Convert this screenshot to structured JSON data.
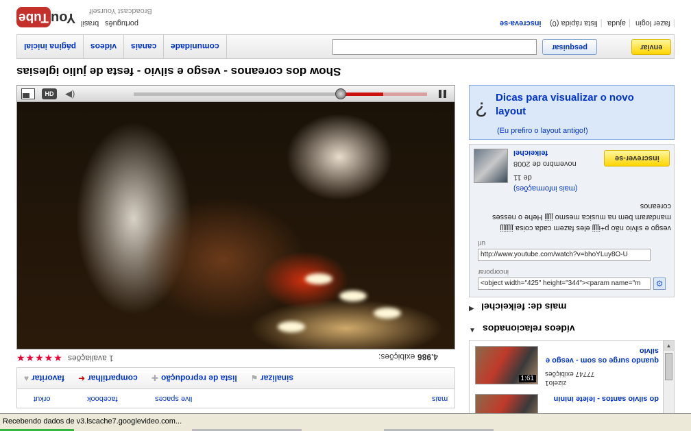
{
  "header": {
    "logo_you": "You",
    "logo_tube": "Tube",
    "tagline": "Broadcast Yourself",
    "languages": [
      "brasil",
      "português"
    ],
    "top_links": [
      "inscreva-se",
      "lista rápida (0)",
      "ajuda",
      "fazer login"
    ]
  },
  "nav": {
    "tabs": [
      "página inicial",
      "vídeos",
      "canais",
      "comunidade"
    ],
    "search_placeholder": "",
    "search_label": "pesquisar",
    "upload_label": "enviar"
  },
  "video": {
    "title": "Show dos coreanos - vesgo e silvio - festa de julio iglesias"
  },
  "player": {
    "hd_label": "HD",
    "progress": 0.85
  },
  "below": {
    "stars": "★★★★★",
    "ratings_text": "1 avaliações",
    "views_text": "exibições:",
    "views_count": "4.986"
  },
  "actions": {
    "favorite": "favoritar",
    "share": "compartilhar",
    "playlist": "lista de reprodução",
    "flag": "sinalizar"
  },
  "share_row": [
    "orkut",
    "facebook",
    "live spaces",
    "mais"
  ],
  "sidebar": {
    "tips_title": "Dicas para visualizar o novo layout",
    "tips_old": "(Eu prefiro o layout antigo!)",
    "channel_name": "feikeichel",
    "channel_date": "novembro de 2008",
    "channel_de": "de 11",
    "channel_more": "(mais informações)",
    "subscribe_label": "inscrever-se",
    "description": "vesgo e silvio não p+ijjjj eles fazem cada coisa jjjjjjjj mandaram bem na musica mesmo jjjjj Hehe o nesses coreanos",
    "url_label": "url",
    "url_value": "http://www.youtube.com/watch?v=bhoYLuy8O-U",
    "embed_label": "incorporar",
    "embed_value": "<object width=\"425\" height=\"344\"><param name=\"m",
    "more_from": "mais de: feikeichel",
    "related_header": "vídeos relacionados"
  },
  "related": [
    {
      "title": "quando surge os som - vesgo e silvio",
      "meta1": "77747 exibições",
      "meta2": "zizelo1",
      "duration": "1:61"
    },
    {
      "title": "do silvio santos - lelete ininin",
      "meta1": "",
      "meta2": "",
      "duration": ""
    }
  ],
  "statusbar": {
    "text": "Recebendo dados de v3.lscache7.googlevideo.com..."
  }
}
